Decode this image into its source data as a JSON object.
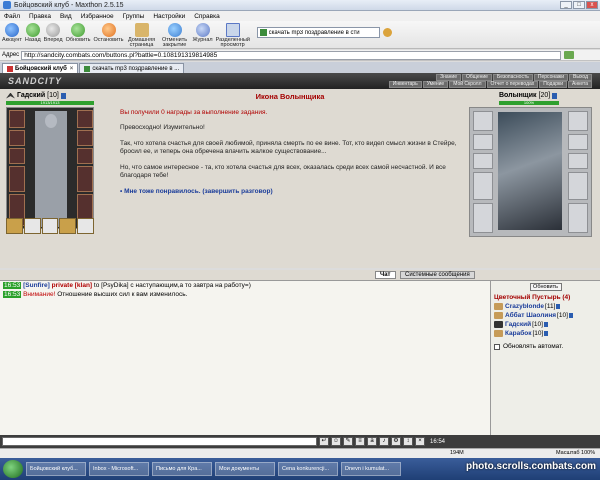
{
  "window": {
    "title": "Бойцовский клуб - Maxthon 2.5.15",
    "minimize": "_",
    "maximize": "□",
    "close": "x"
  },
  "menu": [
    "Файл",
    "Правка",
    "Вид",
    "Избранное",
    "Группы",
    "Настройки",
    "Справка"
  ],
  "toolbar": {
    "buttons": [
      {
        "label": "Аккаунт",
        "icon": "account-icon"
      },
      {
        "label": "Назад",
        "icon": "back-icon"
      },
      {
        "label": "Вперед",
        "icon": "forward-icon"
      },
      {
        "label": "Обновить",
        "icon": "refresh-icon"
      },
      {
        "label": "Остановить",
        "icon": "stop-icon"
      },
      {
        "label": "Домашняя страница",
        "icon": "home-icon"
      },
      {
        "label": "Отменить закрытие",
        "icon": "undo-close-icon"
      },
      {
        "label": "Журнал",
        "icon": "history-icon"
      },
      {
        "label": "Разделенный просмотр",
        "icon": "split-view-icon"
      }
    ],
    "search_value": "скачать mp3 поздравление в сти"
  },
  "address": {
    "label": "Адрес",
    "url": "http://sandcity.combats.com/buttons.pl?battle=0.108191319814985"
  },
  "tabs": [
    {
      "label": "Бойцовский клуб"
    },
    {
      "label": "скачать mp3 поздравление в ..."
    }
  ],
  "game": {
    "logo": "SANDCITY",
    "nav_top": [
      "Знание",
      "Общение",
      "Безопасность",
      "Персонажи",
      "Выход"
    ],
    "nav_bottom": [
      "Инвентарь",
      "Умение",
      "Мой Скролл",
      "Отчет о переводах",
      "Подарки",
      "Анкета"
    ],
    "player": {
      "name": "Гадский",
      "level": "[10]",
      "hp": "1913/1913"
    },
    "npc": {
      "name": "Волынщик",
      "level": "[20]",
      "hp": "100%"
    },
    "dialog": {
      "title": "Икона Волынщика",
      "awards": "Вы получили 0 награды за выполнение задания.",
      "p1": "Превосходно! Изумительно!",
      "p2": "Так, что хотела счастья для своей любимой, приняла смерть по ее вине. Тот, кто видел смысл жизни в Стейре, бросил ее, и теперь она обречена влачить жалкое существование...",
      "p3": "Но, что самое интересное - та, кто хотела счастья для всех, оказалась среди всех самой несчастной. И все благодаря тебе!",
      "choice": "• Мне тоже понравилось. (завершить разговор)"
    }
  },
  "chat": {
    "tabs": [
      "Чат",
      "Системные сообщения"
    ],
    "lines": [
      {
        "time": "16:53",
        "sender": "[Sunfire]",
        "priv": "private [klan]",
        "to": "to",
        "target": "[PsyDika]",
        "text": "с наступающим,а то завтра на работу=)"
      },
      {
        "time": "16:53",
        "warn": "Внимание!",
        "text": "Отношение высших сил к вам изменилось."
      }
    ]
  },
  "online": {
    "refresh": "Обновить",
    "room": "Цветочный Пустырь (4)",
    "users": [
      {
        "nick": "Crazyblonde",
        "level": "[11]"
      },
      {
        "nick": "Аббат Шаолиня",
        "level": "[10]"
      },
      {
        "nick": "Гадский",
        "level": "[10]"
      },
      {
        "nick": "Карабок",
        "level": "[10]"
      }
    ],
    "auto_refresh": "Обновлять автомат."
  },
  "inputbar": {
    "clock": "16:54"
  },
  "statusbar": {
    "memory": "194M",
    "zoom": "Масштаб 100%"
  },
  "taskbar": {
    "items": [
      "Бойцовский клуб...",
      "Inbox - Microsoft...",
      "Письмо для Кра...",
      "Мои документы",
      "Cena konkurencji...",
      "Dnevn i kumulat..."
    ],
    "watermark": "photo.scrolls.combats.com"
  },
  "colors": {
    "accent_red": "#a40000",
    "link_blue": "#1a3c9a",
    "hp_green": "#2fa02f"
  }
}
